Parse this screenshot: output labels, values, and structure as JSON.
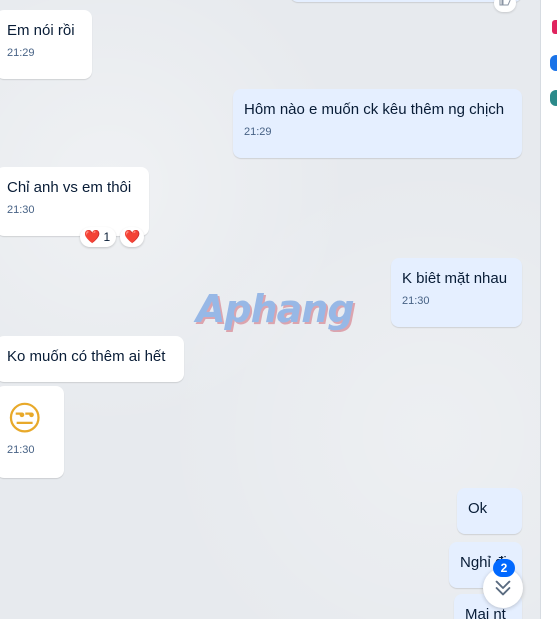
{
  "messages": [
    {
      "side": "incoming",
      "text": "Em nói rồi",
      "time": "21:29"
    },
    {
      "side": "outgoing",
      "text": "Hôm nào e muốn ck kêu thêm ng chịch",
      "time": "21:29"
    },
    {
      "side": "incoming",
      "text": "Chỉ anh vs em thôi",
      "time": "21:30",
      "reactions": {
        "first": "❤️",
        "count": "1",
        "quick": "❤️"
      }
    },
    {
      "side": "outgoing",
      "text": "K biêt mặt nhau",
      "time": "21:30"
    },
    {
      "side": "incoming",
      "text": "Ko muốn có thêm ai hết"
    },
    {
      "side": "incoming",
      "text": "😒",
      "time": "21:30"
    },
    {
      "side": "outgoing",
      "text": "Ok"
    },
    {
      "side": "outgoing",
      "text": "Nghỉ đi"
    },
    {
      "side": "outgoing",
      "text": "Mai nt"
    }
  ],
  "watermark": "Aphang",
  "scroll_down": {
    "badge": "2"
  },
  "icons": [
    "like-icon",
    "heart-icon",
    "double-chevron-down-icon"
  ],
  "colors": {
    "incoming": "#ffffff",
    "outgoing": "#e5efff",
    "badge": "#0068ff",
    "heart": "#e5243b"
  }
}
